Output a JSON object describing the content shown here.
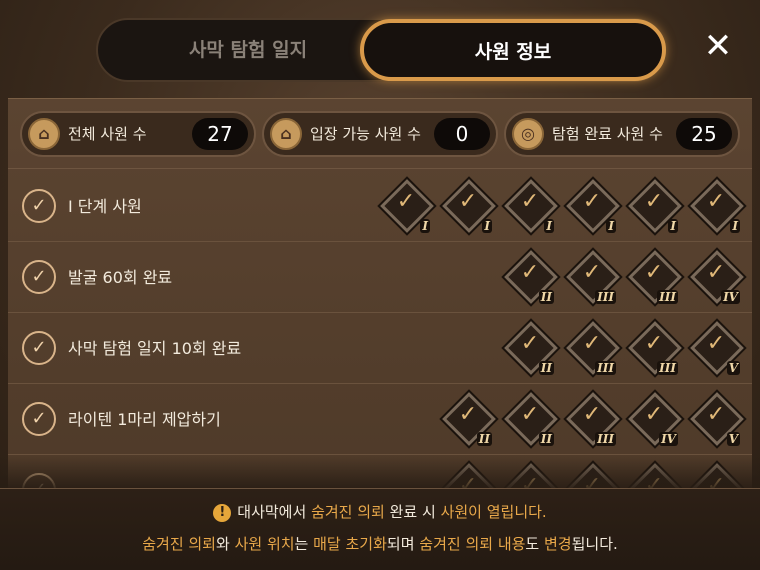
{
  "tabs": [
    {
      "label": "사막 탐험 일지",
      "active": false
    },
    {
      "label": "사원 정보",
      "active": true
    }
  ],
  "close": {
    "icon": "close-icon",
    "glyph": "✕"
  },
  "stats": [
    {
      "icon": "temple-icon",
      "label": "전체 사원 수",
      "value": "27"
    },
    {
      "icon": "temple-icon",
      "label": "입장 가능 사원 수",
      "value": "0"
    },
    {
      "icon": "compass-icon",
      "label": "탐험 완료 사원 수",
      "value": "25"
    }
  ],
  "rows": [
    {
      "label": "Ⅰ 단계 사원",
      "badges": [
        "I",
        "I",
        "I",
        "I",
        "I",
        "I"
      ]
    },
    {
      "label": "발굴 60회 완료",
      "badges": [
        "II",
        "III",
        "III",
        "IV"
      ]
    },
    {
      "label": "사막 탐험 일지 10회 완료",
      "badges": [
        "II",
        "III",
        "III",
        "V"
      ]
    },
    {
      "label": "라이텐 1마리 제압하기",
      "badges": [
        "II",
        "II",
        "III",
        "IV",
        "V"
      ]
    },
    {
      "label": "",
      "badges": [
        "",
        "",
        "",
        "",
        ""
      ]
    }
  ],
  "notice": {
    "line1": [
      {
        "text": "대사막에서 ",
        "hl": false
      },
      {
        "text": "숨겨진 의뢰",
        "hl": true
      },
      {
        "text": " 완료 시 ",
        "hl": false
      },
      {
        "text": "사원이 열립니다.",
        "hl": true
      }
    ],
    "line2": [
      {
        "text": "숨겨진 의뢰",
        "hl": true
      },
      {
        "text": "와 ",
        "hl": false
      },
      {
        "text": "사원 위치",
        "hl": true
      },
      {
        "text": "는 ",
        "hl": false
      },
      {
        "text": "매달 초기화",
        "hl": true
      },
      {
        "text": "되며 ",
        "hl": false
      },
      {
        "text": "숨겨진 의뢰 내용",
        "hl": true
      },
      {
        "text": "도 ",
        "hl": false
      },
      {
        "text": "변경",
        "hl": true
      },
      {
        "text": "됩니다.",
        "hl": false
      }
    ]
  },
  "colors": {
    "accent": "#d99a4a",
    "highlight": "#e8a84a",
    "panel": "#5b4431"
  }
}
